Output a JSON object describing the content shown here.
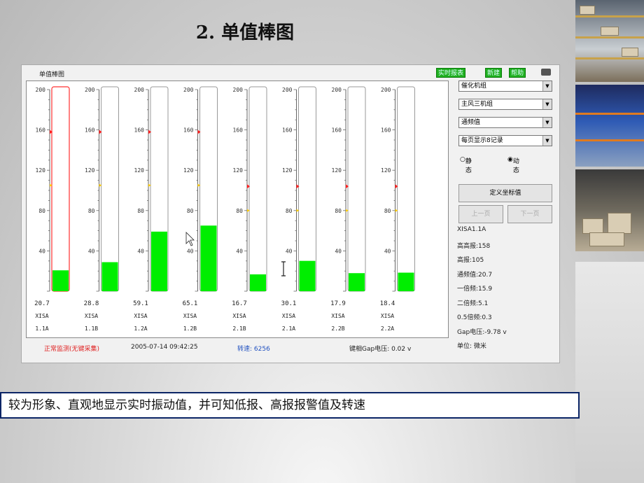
{
  "slide": {
    "title": "2. 单值棒图",
    "caption": "较为形象、直观地显示实时振动值，并可知低报、高报报警值及转速"
  },
  "window": {
    "title": "单值棒图",
    "tags": [
      "实时报表",
      "新建",
      "帮助"
    ]
  },
  "chart_data": {
    "type": "bar",
    "title": "单值棒图",
    "ylim": [
      0,
      200
    ],
    "y_ticks": [
      "200",
      "160",
      "120",
      "80",
      "40"
    ],
    "bars": [
      {
        "value": 20.7,
        "display": "20.7",
        "sensor": "XISA",
        "channel": "1.1A",
        "selected": true,
        "high_alarm": 158,
        "low_alarm": 105
      },
      {
        "value": 28.8,
        "display": "28.8",
        "sensor": "XISA",
        "channel": "1.1B",
        "selected": false,
        "high_alarm": 158,
        "low_alarm": 105
      },
      {
        "value": 59.1,
        "display": "59.1",
        "sensor": "XISA",
        "channel": "1.2A",
        "selected": false,
        "high_alarm": 158,
        "low_alarm": 105
      },
      {
        "value": 65.1,
        "display": "65.1",
        "sensor": "XISA",
        "channel": "1.2B",
        "selected": false,
        "high_alarm": 158,
        "low_alarm": 105
      },
      {
        "value": 16.7,
        "display": "16.7",
        "sensor": "XISA",
        "channel": "2.1B",
        "selected": false,
        "high_alarm": 104,
        "low_alarm": 80
      },
      {
        "value": 30.1,
        "display": "30.1",
        "sensor": "XISA",
        "channel": "2.1A",
        "selected": false,
        "high_alarm": 104,
        "low_alarm": 80
      },
      {
        "value": 17.9,
        "display": "17.9",
        "sensor": "XISA",
        "channel": "2.2B",
        "selected": false,
        "high_alarm": 104,
        "low_alarm": 80
      },
      {
        "value": 18.4,
        "display": "18.4",
        "sensor": "XISA",
        "channel": "2.2A",
        "selected": false,
        "high_alarm": 104,
        "low_alarm": 80
      }
    ]
  },
  "status": {
    "mode": "正常监测(无键采集)",
    "datetime": "2005-07-14 09:42:25",
    "speed": "转速: 6256",
    "gap": "键相Gap电压: 0.02 v"
  },
  "controls": {
    "selects": [
      "催化机组",
      "主风三机组",
      "通频值",
      "每页显示8记录"
    ],
    "radio_static": "静态",
    "radio_dynamic": "动态",
    "radio_selected": "dynamic",
    "define_button": "定义坐标值",
    "prev_button": "上一页",
    "next_button": "下一页"
  },
  "info": [
    "XISA1.1A",
    "高高报:158",
    "高报:105",
    "通频值:20.7",
    "一倍频:15.9",
    "二倍频:5.1",
    "0.5倍频:0.3",
    "Gap电压:-9.78 v",
    "单位: 微米"
  ],
  "colors": {
    "bar_fill": "#00ee00",
    "selected_outline": "#ff3030",
    "alarm_high": "#ff2020",
    "alarm_low": "#ffcc00",
    "tag_bg": "#20b020",
    "caption_border": "#0b2566"
  },
  "icons": [
    "printer-icon",
    "mouse-cursor-icon",
    "text-cursor-icon"
  ]
}
